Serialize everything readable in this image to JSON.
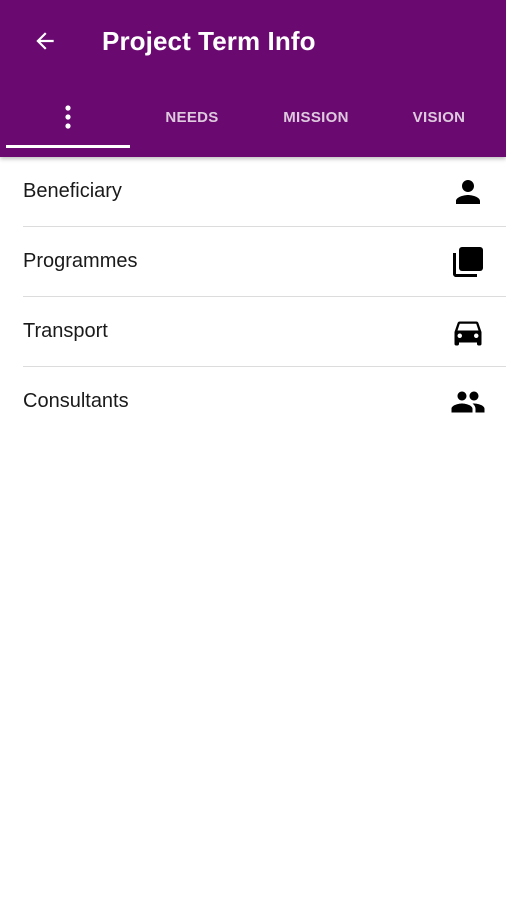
{
  "header": {
    "title": "Project Term Info",
    "background_color": "#6a0a70"
  },
  "tabs": [
    {
      "label": "",
      "icon": "more-vert-icon",
      "selected": true
    },
    {
      "label": "NEEDS",
      "selected": false
    },
    {
      "label": "MISSION",
      "selected": false
    },
    {
      "label": "VISION",
      "selected": false
    }
  ],
  "list": [
    {
      "label": "Beneficiary",
      "icon": "person-icon"
    },
    {
      "label": "Programmes",
      "icon": "library-icon"
    },
    {
      "label": "Transport",
      "icon": "car-icon"
    },
    {
      "label": "Consultants",
      "icon": "people-icon"
    }
  ]
}
